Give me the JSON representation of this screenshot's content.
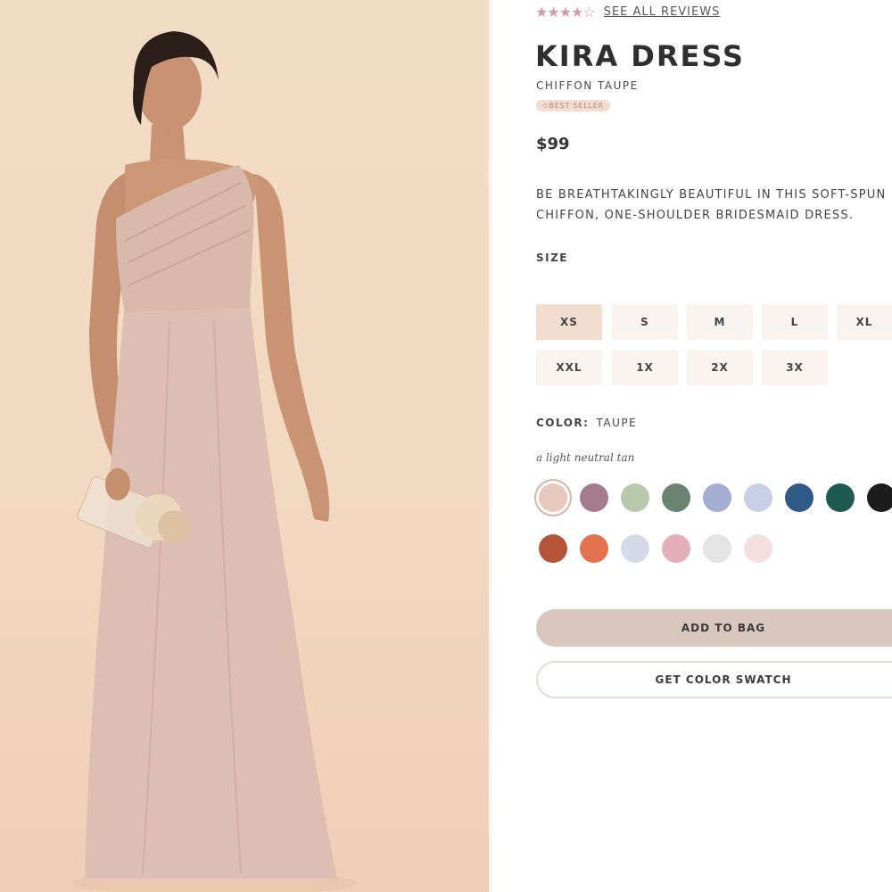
{
  "product": {
    "rating_stars": "★★★★☆",
    "reviews_link": "SEE ALL REVIEWS",
    "name": "KIRA DRESS",
    "variant": "CHIFFON TAUPE",
    "badge": "✩BEST SELLER",
    "price": "$99",
    "description_line1": "BE BREATHTAKINGLY BEAUTIFUL IN THIS SOFT-SPUN",
    "description_line2": "CHIFFON, ONE-SHOULDER BRIDESMAID DRESS."
  },
  "size": {
    "label": "SIZE",
    "options": [
      "XS",
      "S",
      "M",
      "L",
      "XL",
      "XXL",
      "1X",
      "2X",
      "3X"
    ],
    "selected": "XS"
  },
  "color": {
    "label": "COLOR:",
    "selected_name": "TAUPE",
    "selected_description": "a light neutral tan",
    "swatches": [
      "#e7c9bd",
      "#a67c8c",
      "#b9c9ad",
      "#6b8472",
      "#a3aed2",
      "#c7d0e6",
      "#2f5a86",
      "#1f5a52",
      "#1c1c1c",
      "#b45439",
      "#e2734e",
      "#d6dae8",
      "#e5aebb",
      "#e4e4e4",
      "#f3dfe0"
    ]
  },
  "actions": {
    "add_to_bag": "ADD TO BAG",
    "get_swatch": "GET COLOR SWATCH"
  }
}
